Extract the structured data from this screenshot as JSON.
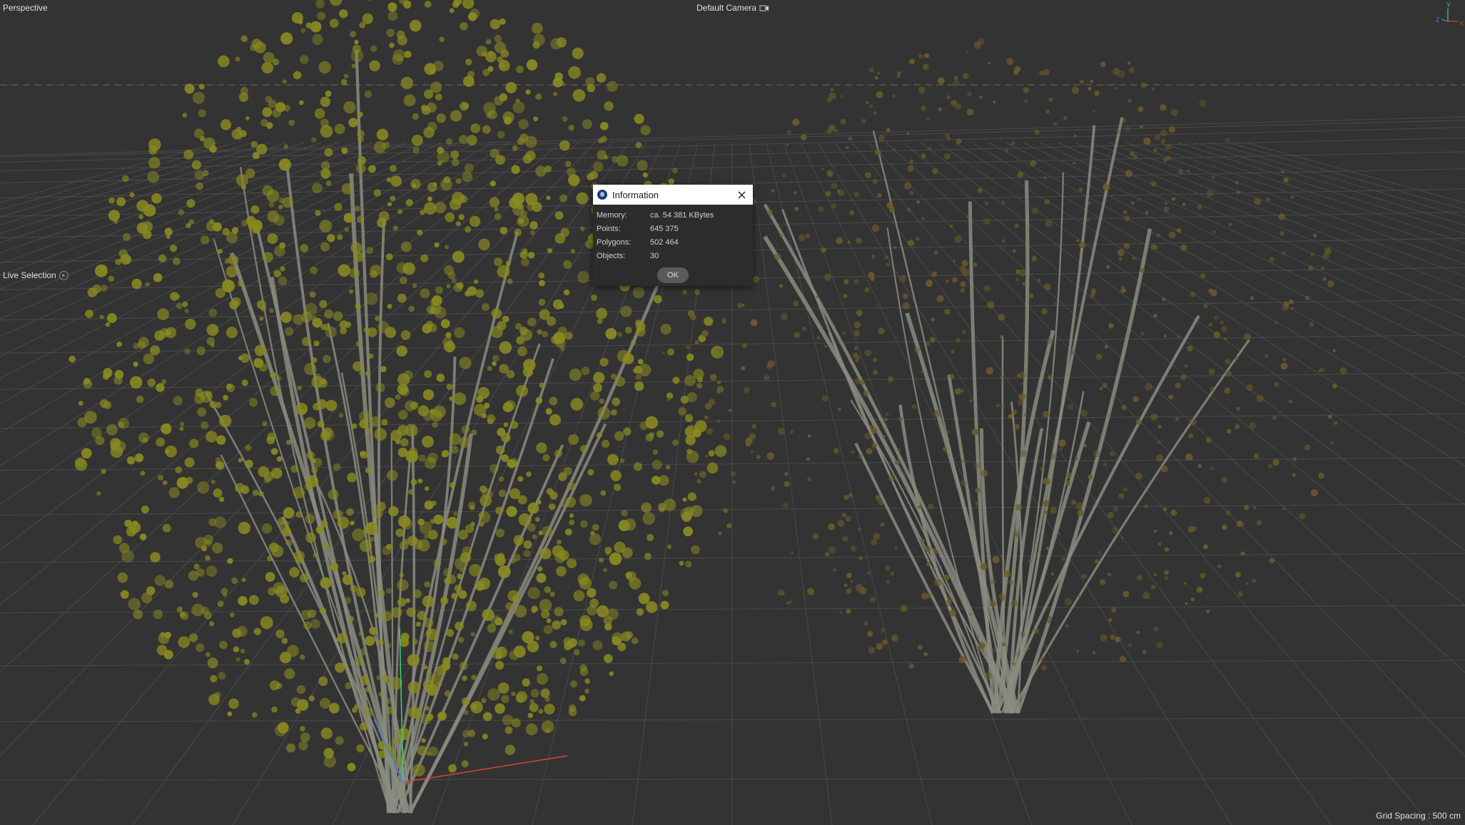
{
  "viewport": {
    "view_name": "Perspective",
    "camera_name": "Default Camera",
    "active_tool": "Live Selection",
    "grid_spacing": "Grid Spacing : 500 cm",
    "axis_labels": {
      "x": "X",
      "y": "Y",
      "z": "Z"
    }
  },
  "dialog": {
    "title": "Information",
    "rows": [
      {
        "label": "Memory:",
        "value": "ca. 54 381 KBytes"
      },
      {
        "label": "Points:",
        "value": "645 375"
      },
      {
        "label": "Polygons:",
        "value": "502 464"
      },
      {
        "label": "Objects:",
        "value": "30"
      }
    ],
    "ok_label": "OK"
  },
  "colors": {
    "background": "#333333",
    "grid_line": "#4a4a4a",
    "horizon_line": "#6a6a6a",
    "foliage_left": "#8a8a22",
    "foliage_right": "#6b5a2a",
    "bark": "#8a8c80",
    "axis_x": "#d9443b",
    "axis_y": "#3fcf7a",
    "axis_z": "#4a7fd6"
  }
}
